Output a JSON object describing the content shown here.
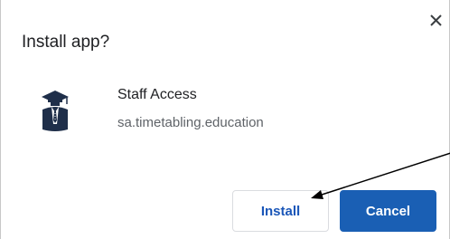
{
  "dialog": {
    "title": "Install app?",
    "close_icon": "close-icon"
  },
  "app": {
    "icon": "graduate-icon",
    "name": "Staff Access",
    "url": "sa.timetabling.education"
  },
  "buttons": {
    "install_label": "Install",
    "cancel_label": "Cancel"
  },
  "colors": {
    "primary": "#1a5fb4",
    "annotation_arrow": "#000000"
  }
}
